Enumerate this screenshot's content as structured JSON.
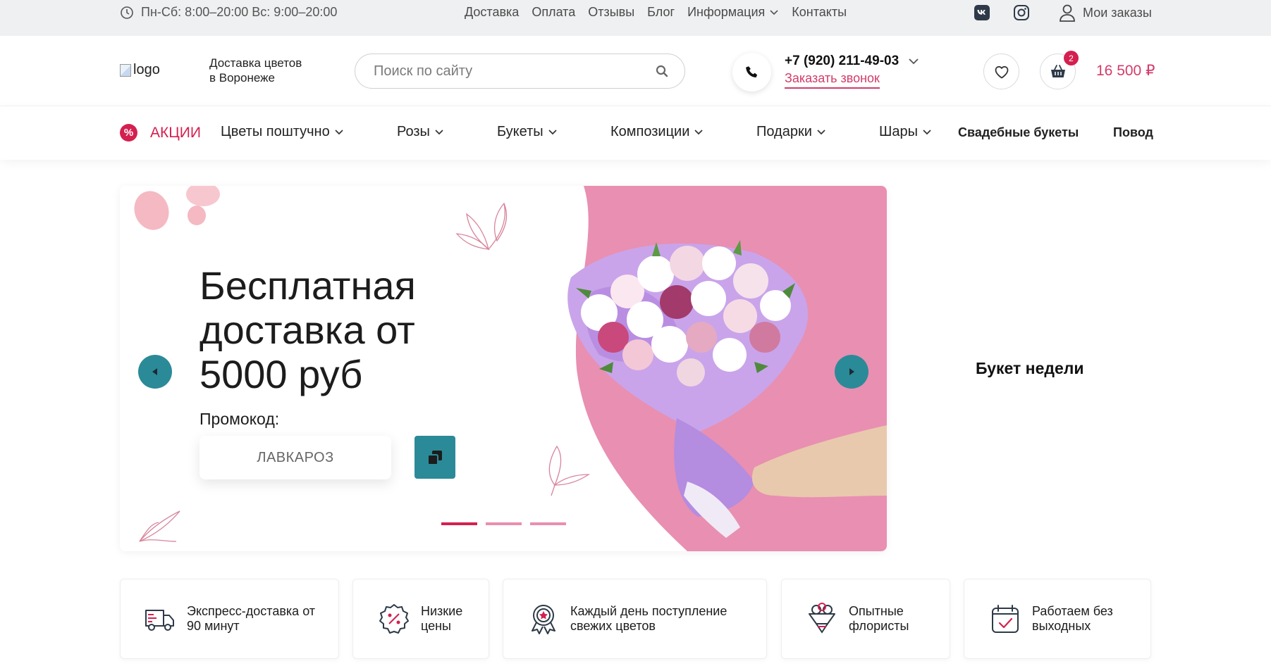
{
  "topbar": {
    "hours": "Пн-Сб: 8:00–20:00 Вс: 9:00–20:00",
    "nav": [
      "Доставка",
      "Оплата",
      "Отзывы",
      "Блог",
      "Информация",
      "Контакты"
    ],
    "my_orders": "Мои заказы",
    "social_icons": [
      "vk-icon",
      "instagram-icon"
    ]
  },
  "header": {
    "logo_alt": "logo",
    "tagline_line1": "Доставка цветов",
    "tagline_line2": "в Воронеже",
    "search_placeholder": "Поиск по сайту",
    "phone": "+7 (920) 211-49-03",
    "callback": "Заказать звонок",
    "cart_count": "2",
    "cart_total": "16 500 ₽"
  },
  "mainnav": {
    "promo": "АКЦИИ",
    "items": [
      "Цветы поштучно",
      "Розы",
      "Букеты",
      "Композиции",
      "Подарки",
      "Шары",
      "Свадебные букеты",
      "Повод"
    ]
  },
  "hero": {
    "title_line1": "Бесплатная",
    "title_line2": "доставка от",
    "title_line3": "5000 руб",
    "promo_label": "Промокод:",
    "promo_code": "ЛАВКАРОЗ",
    "slides_total": 3,
    "active_slide": 1
  },
  "side": {
    "bouquet_of_week": "Букет недели"
  },
  "features": [
    {
      "icon": "truck-icon",
      "line1": "Экспресс-доставка от",
      "line2": "90 минут"
    },
    {
      "icon": "discount-icon",
      "line1": "Низкие",
      "line2": "цены"
    },
    {
      "icon": "award-icon",
      "line1": "Каждый день поступление",
      "line2": "свежих цветов"
    },
    {
      "icon": "bouquet-icon",
      "line1": "Опытные",
      "line2": "флористы"
    },
    {
      "icon": "calendar-icon",
      "line1": "Работаем без",
      "line2": "выходных"
    }
  ],
  "colors": {
    "accent": "#d4204f",
    "teal": "#2b8a98",
    "pink_bg": "#e98fb1",
    "topbar_bg": "#eff0f2"
  }
}
